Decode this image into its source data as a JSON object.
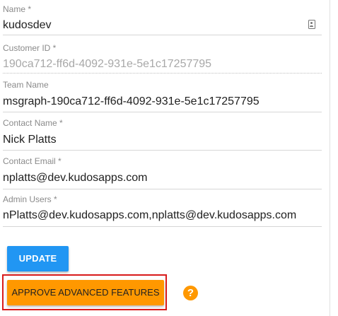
{
  "form": {
    "name": {
      "label": "Name *",
      "value": "kudosdev"
    },
    "customer_id": {
      "label": "Customer ID *",
      "value": "190ca712-ff6d-4092-931e-5e1c17257795"
    },
    "team_name": {
      "label": "Team Name",
      "value": "msgraph-190ca712-ff6d-4092-931e-5e1c17257795"
    },
    "contact_name": {
      "label": "Contact Name *",
      "value": "Nick Platts"
    },
    "contact_email": {
      "label": "Contact Email *",
      "value": "nplatts@dev.kudosapps.com"
    },
    "admin_users": {
      "label": "Admin Users *",
      "value": "nPlatts@dev.kudosapps.com,nplatts@dev.kudosapps.com"
    }
  },
  "actions": {
    "update_label": "UPDATE",
    "approve_label": "APPROVE ADVANCED FEATURES",
    "help_glyph": "?"
  },
  "icons": {
    "contact": "contact-card-icon",
    "help": "help-icon"
  },
  "colors": {
    "update_button": "#2196f3",
    "approve_button": "#ff9800",
    "help_icon": "#ff9800",
    "highlight_border": "#d81b1b"
  }
}
